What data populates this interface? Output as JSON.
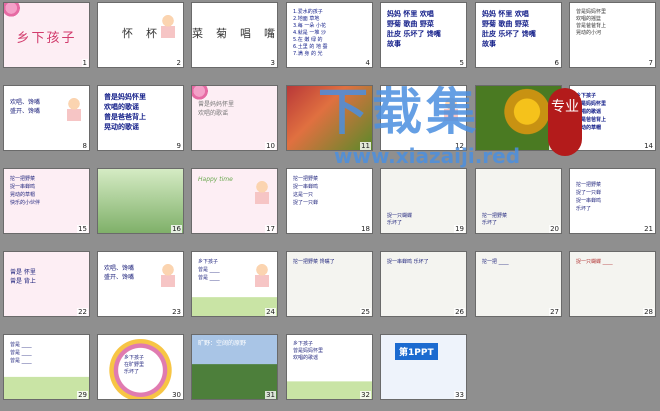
{
  "slides": [
    {
      "number": "1",
      "kind": "title",
      "text": "乡下孩子"
    },
    {
      "number": "2",
      "kind": "word",
      "text": "怀  杯"
    },
    {
      "number": "3",
      "kind": "word",
      "text": "菜  菊  唱  嘴"
    },
    {
      "number": "4",
      "kind": "list",
      "text": "1.爱水的孩子\n2.地面 草地\n3.每 一朵 小花\n4.就是 一堆 沙\n5.在 嫩 绿 的\n6.土里 的 地 蚕\n7.满 身 的 光"
    },
    {
      "number": "5",
      "kind": "vocab",
      "text": "妈妈  怀里  欢唱\n野菊  歌曲  野菜\n肚皮  乐坏了  馋嘴\n故事"
    },
    {
      "number": "6",
      "kind": "vocab",
      "text": "妈妈  怀里  欢唱\n野菊  歌曲  野菜\n肚皮  乐坏了  馋嘴\n故事"
    },
    {
      "number": "7",
      "kind": "poem",
      "text": "曾是妈妈怀里\n欢唱的摇篮\n曾是爸爸背上\n晃动的小河"
    },
    {
      "number": "8",
      "kind": "fill",
      "text": "欢唱、馋嘴\n盛开、馋嘴"
    },
    {
      "number": "9",
      "kind": "poem",
      "text": "曾是妈妈怀里\n欢唱的歌谣\n曾是爸爸背上\n晃动的歌谣"
    },
    {
      "number": "10",
      "kind": "poem",
      "text": "曾是妈妈怀里\n欢唱的歌谣"
    },
    {
      "number": "11",
      "kind": "photo",
      "text": ""
    },
    {
      "number": "12",
      "kind": "word",
      "text": ""
    },
    {
      "number": "13",
      "kind": "photo",
      "text": ""
    },
    {
      "number": "14",
      "kind": "poem",
      "text": "乡下孩子\n曾是妈妈怀里\n欢唱的歌谣\n曾是爸爸背上\n晃动的草帽"
    },
    {
      "number": "15",
      "kind": "poem",
      "text": "挖一把野菜\n捉一串蝉鸣\n晃动的草帽\n快乐的小伙伴"
    },
    {
      "number": "16",
      "kind": "insects",
      "text": ""
    },
    {
      "number": "17",
      "kind": "title",
      "text": "Happy time"
    },
    {
      "number": "18",
      "kind": "poem",
      "text": "挖一把野菜\n捉一串蝉鸣\n这是一只\n捉了一只蝉"
    },
    {
      "number": "19",
      "kind": "sketch",
      "text": "捉一只蝴蝶\n乐坏了"
    },
    {
      "number": "20",
      "kind": "sketch",
      "text": "挖一把野菜\n乐坏了"
    },
    {
      "number": "21",
      "kind": "poem",
      "text": "挖一把野菜\n捉了一只蝉\n捉一串蝉鸣\n乐坏了"
    },
    {
      "number": "22",
      "kind": "fill",
      "text": "曾是 怀里\n曾是 背上"
    },
    {
      "number": "23",
      "kind": "fill",
      "text": "欢唱、馋嘴\n盛开、馋嘴"
    },
    {
      "number": "24",
      "kind": "fill",
      "text": "乡下孩子\n曾是 ____\n曾是 ____"
    },
    {
      "number": "25",
      "kind": "sketch",
      "text": "挖一把野菜 馋嘴了"
    },
    {
      "number": "26",
      "kind": "sketch",
      "text": "捉一串蝉鸣 乐坏了"
    },
    {
      "number": "27",
      "kind": "sketch",
      "text": "挖一把 ____"
    },
    {
      "number": "28",
      "kind": "sketch",
      "text": "捉一只蝴蝶 ____"
    },
    {
      "number": "29",
      "kind": "fill",
      "text": "曾是 ____\n曾是 ____\n曾是 ____"
    },
    {
      "number": "30",
      "kind": "wreath",
      "text": "乡下孩子\n在旷野里\n乐坏了"
    },
    {
      "number": "31",
      "kind": "field",
      "text": "旷野：空阔的原野"
    },
    {
      "number": "32",
      "kind": "poem",
      "text": "乡下孩子\n曾是妈妈怀里\n欢唱的歌谣"
    },
    {
      "number": "33",
      "kind": "logo",
      "text": "第1PPT"
    }
  ],
  "watermark": {
    "main": "下载集",
    "url": "www.xiazaiji.red",
    "badge": "专业"
  }
}
